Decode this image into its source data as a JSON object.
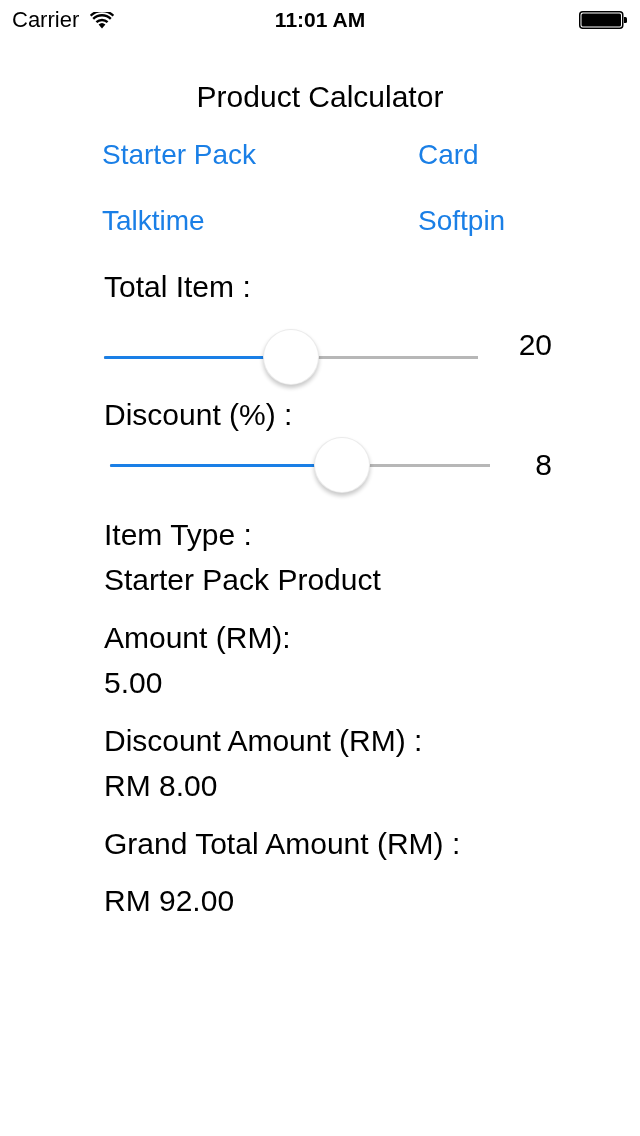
{
  "status_bar": {
    "carrier": "Carrier",
    "time": "11:01 AM"
  },
  "title": "Product Calculator",
  "product_buttons": [
    {
      "label": "Starter Pack"
    },
    {
      "label": "Card"
    },
    {
      "label": "Talktime"
    },
    {
      "label": "Softpin"
    }
  ],
  "sliders": [
    {
      "label": "Total Item :",
      "level": 0.5,
      "reading": "20"
    },
    {
      "label": "Discount (%) :",
      "level": 0.63,
      "reading": "8"
    }
  ],
  "results": [
    {
      "label": "Item Type :",
      "value": "Starter Pack Product"
    },
    {
      "label": "Amount (RM):",
      "value": "5.00"
    },
    {
      "label": "Discount Amount (RM) :",
      "value": "RM 8.00"
    },
    {
      "label": "Grand Total Amount (RM) :",
      "value": "RM 92.00"
    }
  ]
}
